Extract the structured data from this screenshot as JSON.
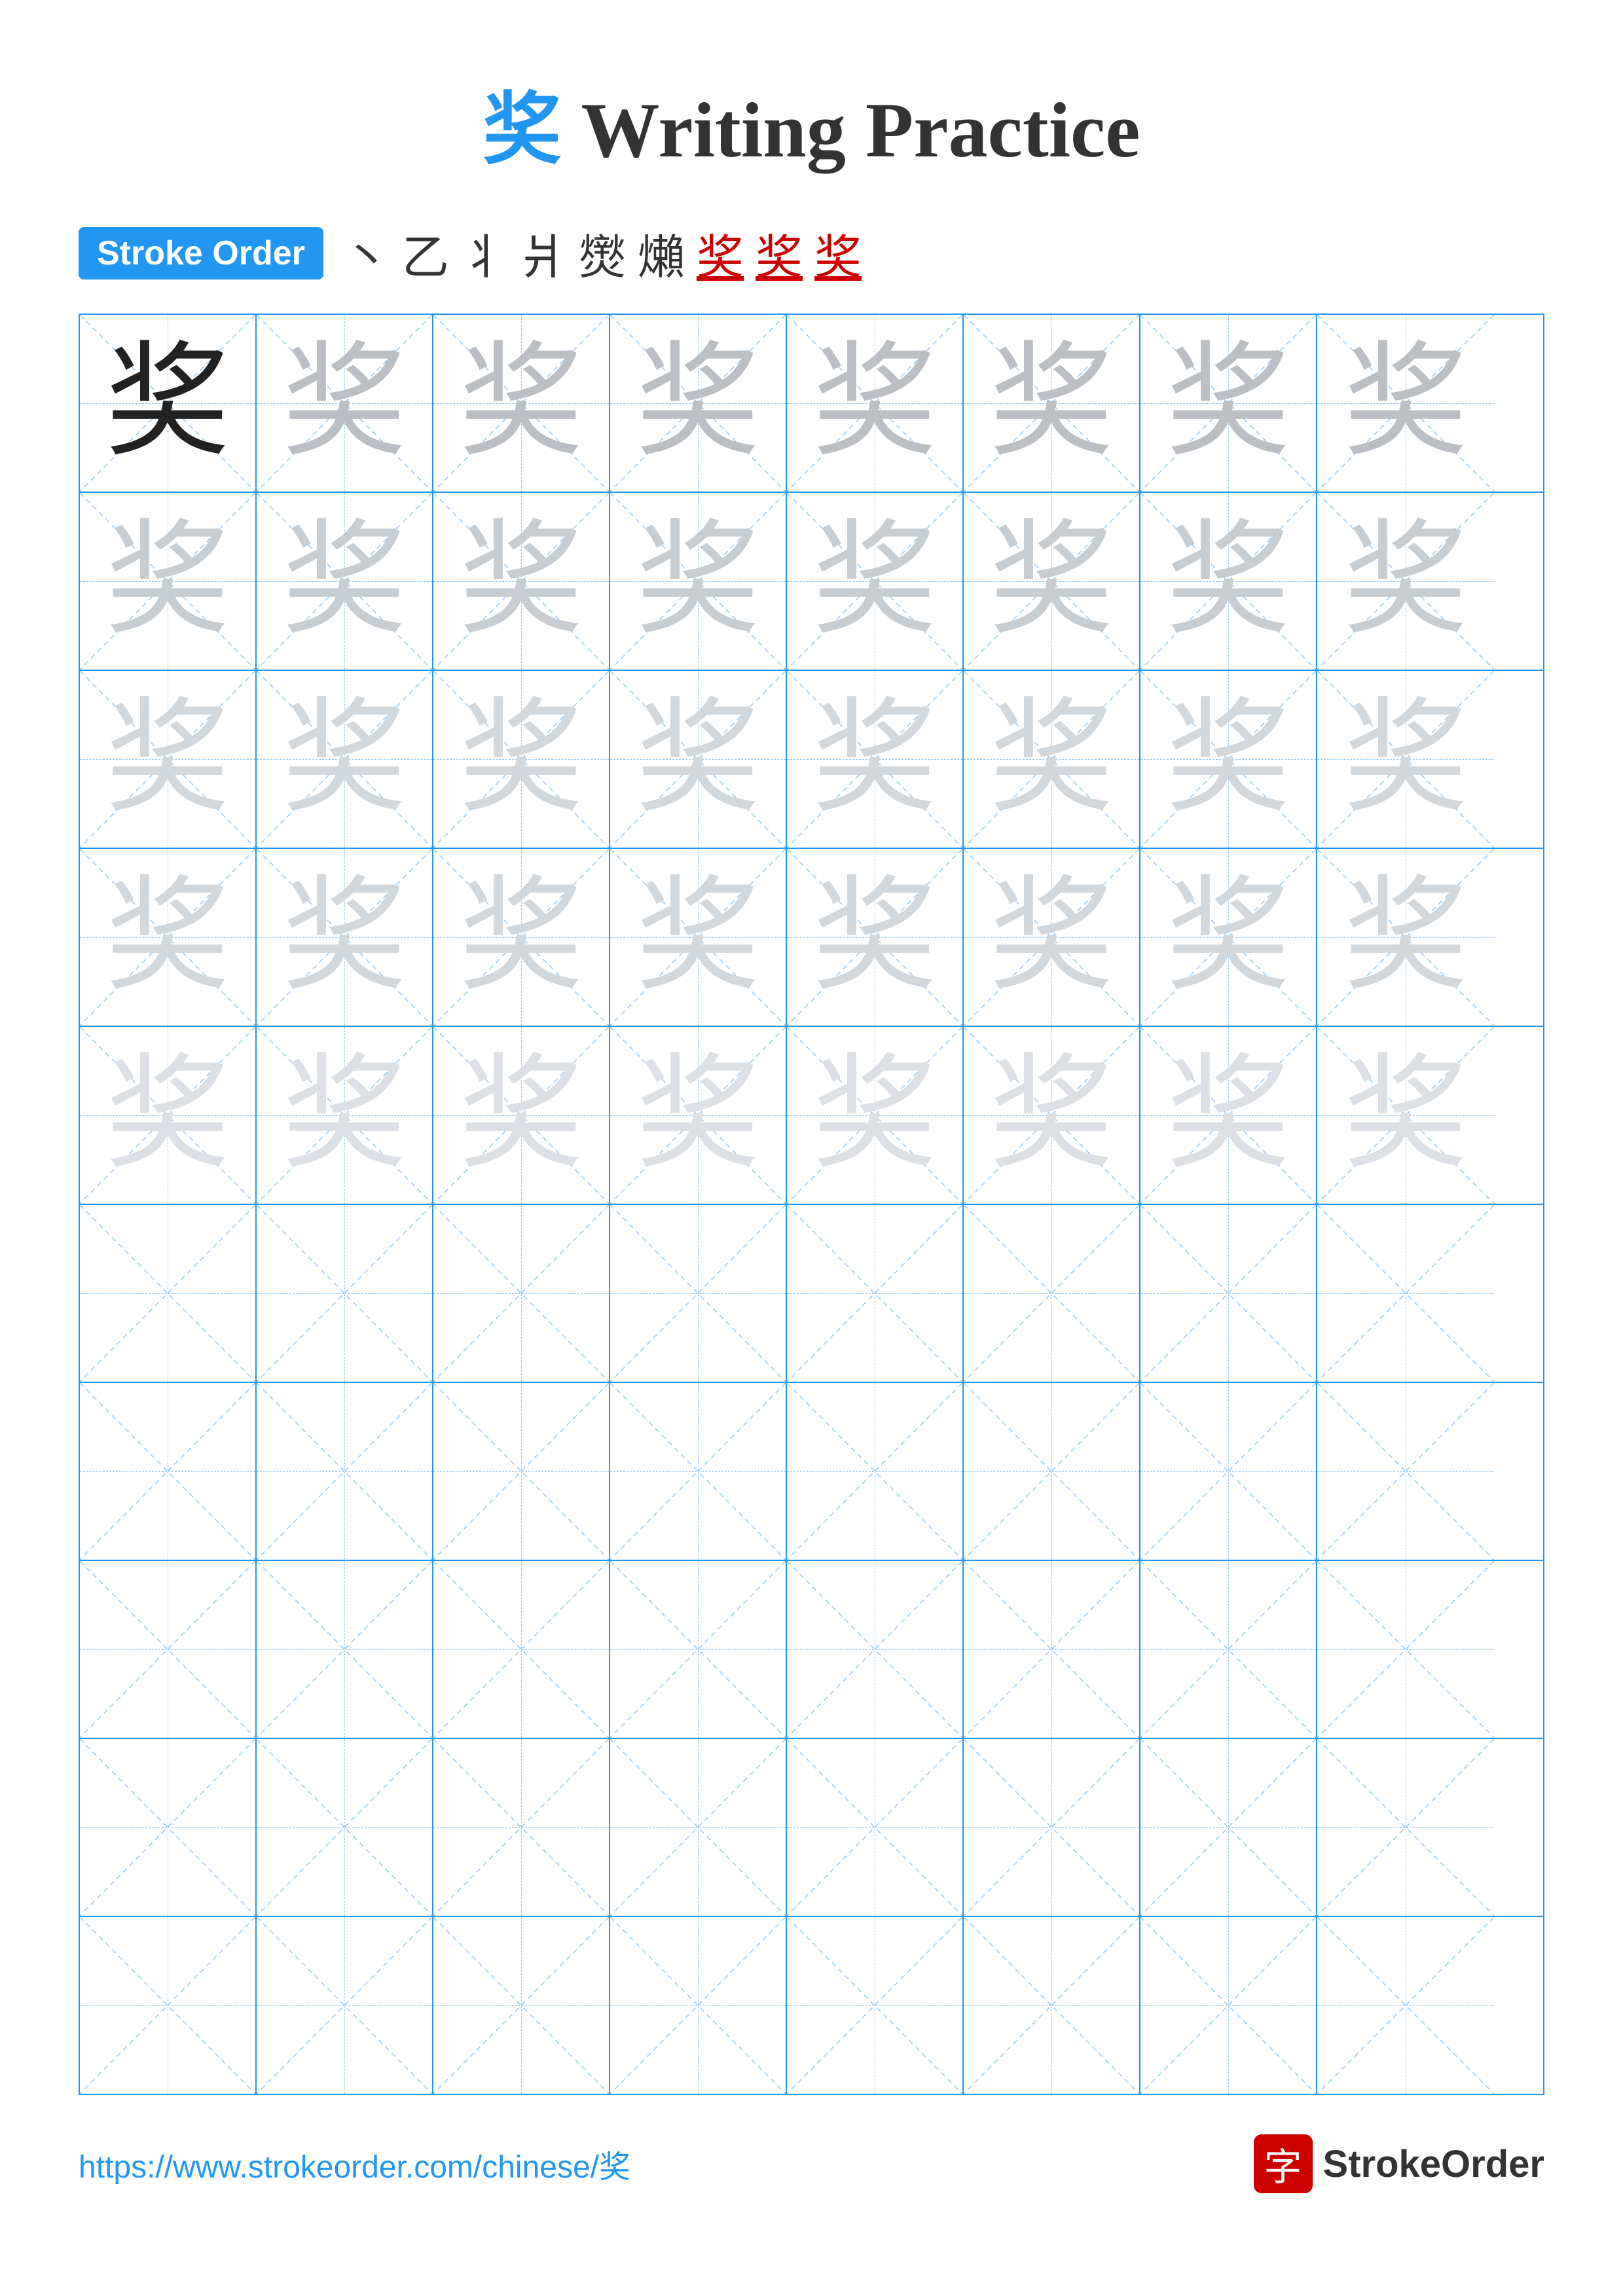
{
  "title": {
    "char": "奖",
    "suffix": " Writing Practice"
  },
  "stroke_order": {
    "badge": "Stroke Order",
    "strokes": [
      "丶",
      "乙",
      "丬",
      "爿",
      "㸉",
      "㸊",
      "㸋",
      "奖̲",
      "奖"
    ]
  },
  "grid": {
    "cols": 8,
    "practice_rows": 5,
    "empty_rows": 5,
    "char": "奖",
    "shades": [
      "dark",
      "light1",
      "light1",
      "light1",
      "light1",
      "light1",
      "light1",
      "light1",
      "light2",
      "light2",
      "light2",
      "light2",
      "light2",
      "light2",
      "light2",
      "light2",
      "light3",
      "light3",
      "light3",
      "light3",
      "light3",
      "light3",
      "light3",
      "light3",
      "light3",
      "light3",
      "light3",
      "light3",
      "light3",
      "light3",
      "light3",
      "light3",
      "light4",
      "light4",
      "light4",
      "light4",
      "light4",
      "light4",
      "light4",
      "light4"
    ]
  },
  "footer": {
    "url": "https://www.strokeorder.com/chinese/奖",
    "logo_char": "字",
    "logo_text": "StrokeOrder"
  }
}
